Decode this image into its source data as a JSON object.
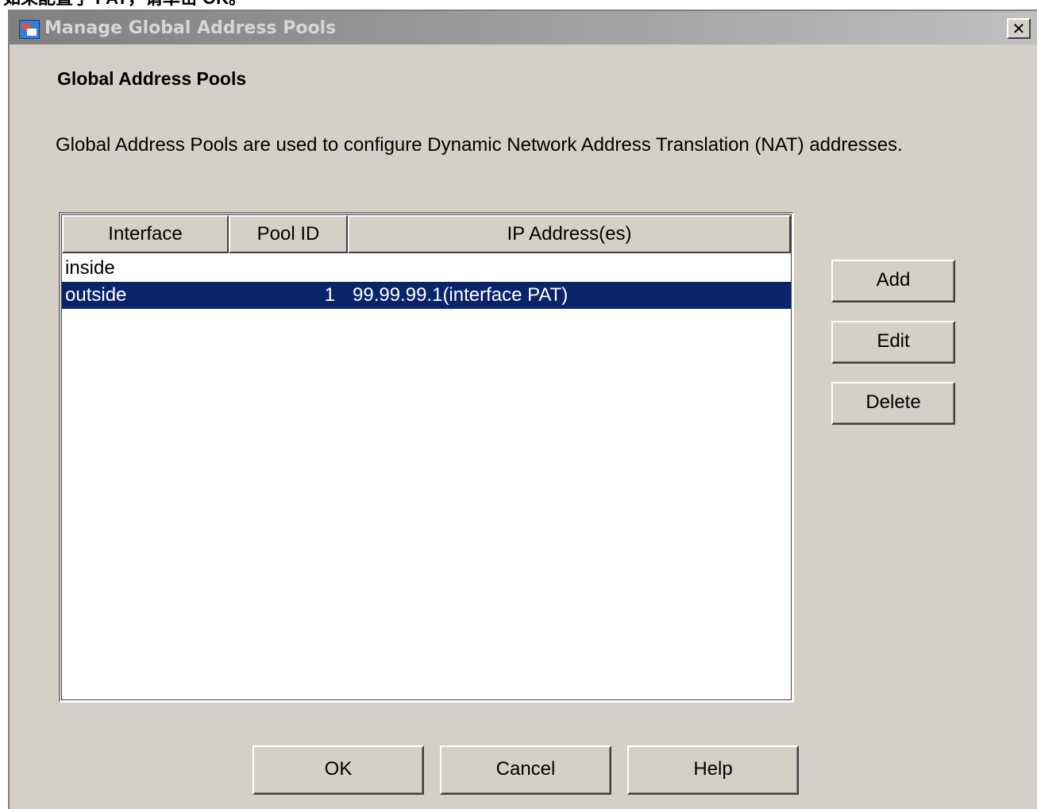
{
  "caption": "如果配置了 PAT，请单击 OK。",
  "window": {
    "title": "Manage Global Address Pools",
    "close_glyph": "✕"
  },
  "heading": "Global Address Pools",
  "description": "Global Address Pools are used to configure Dynamic Network Address Translation (NAT) addresses.",
  "table": {
    "columns": [
      "Interface",
      "Pool ID",
      "IP Address(es)"
    ],
    "rows": [
      {
        "interface": "inside",
        "pool_id": "",
        "ip": ""
      },
      {
        "interface": "outside",
        "pool_id": "1",
        "ip": "99.99.99.1(interface PAT)",
        "selected": true
      }
    ],
    "selection_color": "#0a246a"
  },
  "actions": {
    "add": "Add",
    "edit": "Edit",
    "delete": "Delete"
  },
  "footer": {
    "ok": "OK",
    "cancel": "Cancel",
    "help": "Help"
  },
  "icons": {
    "app": "asdm-app-icon",
    "close": "close-icon"
  }
}
